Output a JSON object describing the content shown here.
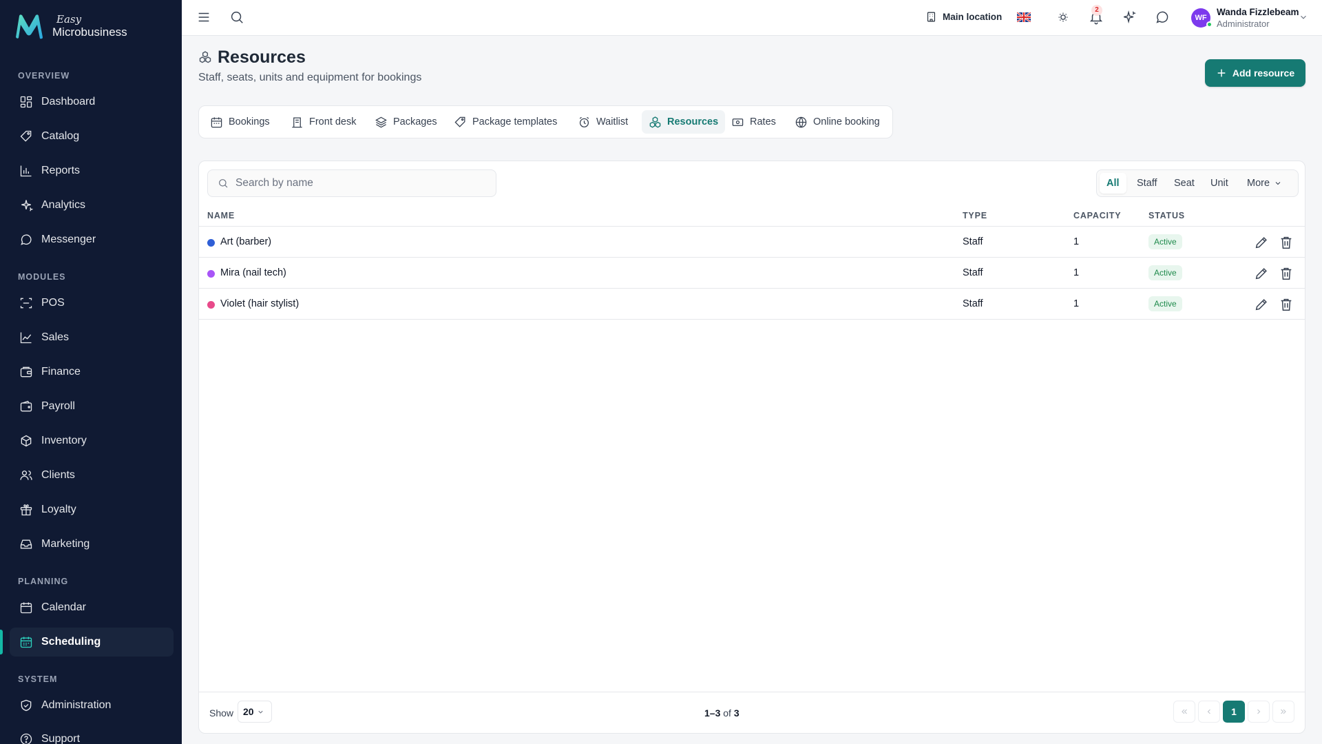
{
  "brand": {
    "easy": "Easy",
    "name": "Microbusiness"
  },
  "sidebar": {
    "sections": [
      {
        "label": "OVERVIEW"
      },
      {
        "label": "MODULES"
      },
      {
        "label": "PLANNING"
      },
      {
        "label": "SYSTEM"
      }
    ],
    "items": [
      {
        "label": "Dashboard",
        "icon": "dashboard-icon"
      },
      {
        "label": "Catalog",
        "icon": "catalog-icon"
      },
      {
        "label": "Reports",
        "icon": "reports-icon"
      },
      {
        "label": "Analytics",
        "icon": "analytics-icon"
      },
      {
        "label": "Messenger",
        "icon": "messenger-icon"
      },
      {
        "label": "POS",
        "icon": "pos-icon"
      },
      {
        "label": "Sales",
        "icon": "sales-icon"
      },
      {
        "label": "Finance",
        "icon": "finance-icon"
      },
      {
        "label": "Payroll",
        "icon": "payroll-icon"
      },
      {
        "label": "Inventory",
        "icon": "inventory-icon"
      },
      {
        "label": "Clients",
        "icon": "clients-icon"
      },
      {
        "label": "Loyalty",
        "icon": "loyalty-icon"
      },
      {
        "label": "Marketing",
        "icon": "marketing-icon"
      },
      {
        "label": "Calendar",
        "icon": "calendar-icon"
      },
      {
        "label": "Scheduling",
        "icon": "scheduling-icon",
        "active": true
      },
      {
        "label": "Administration",
        "icon": "shield-icon"
      },
      {
        "label": "Support",
        "icon": "help-icon"
      }
    ]
  },
  "topbar": {
    "location": "Main location",
    "notifications_count": "2",
    "user": {
      "initials": "WF",
      "name": "Wanda Fizzlebeam",
      "role": "Administrator"
    }
  },
  "header": {
    "title": "Resources",
    "subtitle": "Staff, seats, units and equipment for bookings",
    "add_button": "Add resource"
  },
  "tabs": [
    {
      "label": "Bookings"
    },
    {
      "label": "Front desk"
    },
    {
      "label": "Packages"
    },
    {
      "label": "Package templates"
    },
    {
      "label": "Waitlist"
    },
    {
      "label": "Resources",
      "active": true
    },
    {
      "label": "Rates"
    },
    {
      "label": "Online booking"
    }
  ],
  "search": {
    "placeholder": "Search by name",
    "value": ""
  },
  "filters": [
    "All",
    "Staff",
    "Seat",
    "Unit",
    "More"
  ],
  "table": {
    "columns": [
      "NAME",
      "TYPE",
      "CAPACITY",
      "STATUS"
    ],
    "rows": [
      {
        "name": "Art (barber)",
        "type": "Staff",
        "capacity": "1",
        "status": "Active",
        "color": "#2f5fd6"
      },
      {
        "name": "Mira (nail tech)",
        "type": "Staff",
        "capacity": "1",
        "status": "Active",
        "color": "#a855f7"
      },
      {
        "name": "Violet (hair stylist)",
        "type": "Staff",
        "capacity": "1",
        "status": "Active",
        "color": "#e84a8a"
      }
    ]
  },
  "footer": {
    "show_label": "Show",
    "page_size": "20",
    "range": "1–3",
    "of": "of",
    "total": "3",
    "current_page": "1"
  },
  "colors": {
    "accent": "#167a73",
    "sidebar_bg": "#101a33",
    "status_bg": "#e8f6ee"
  }
}
